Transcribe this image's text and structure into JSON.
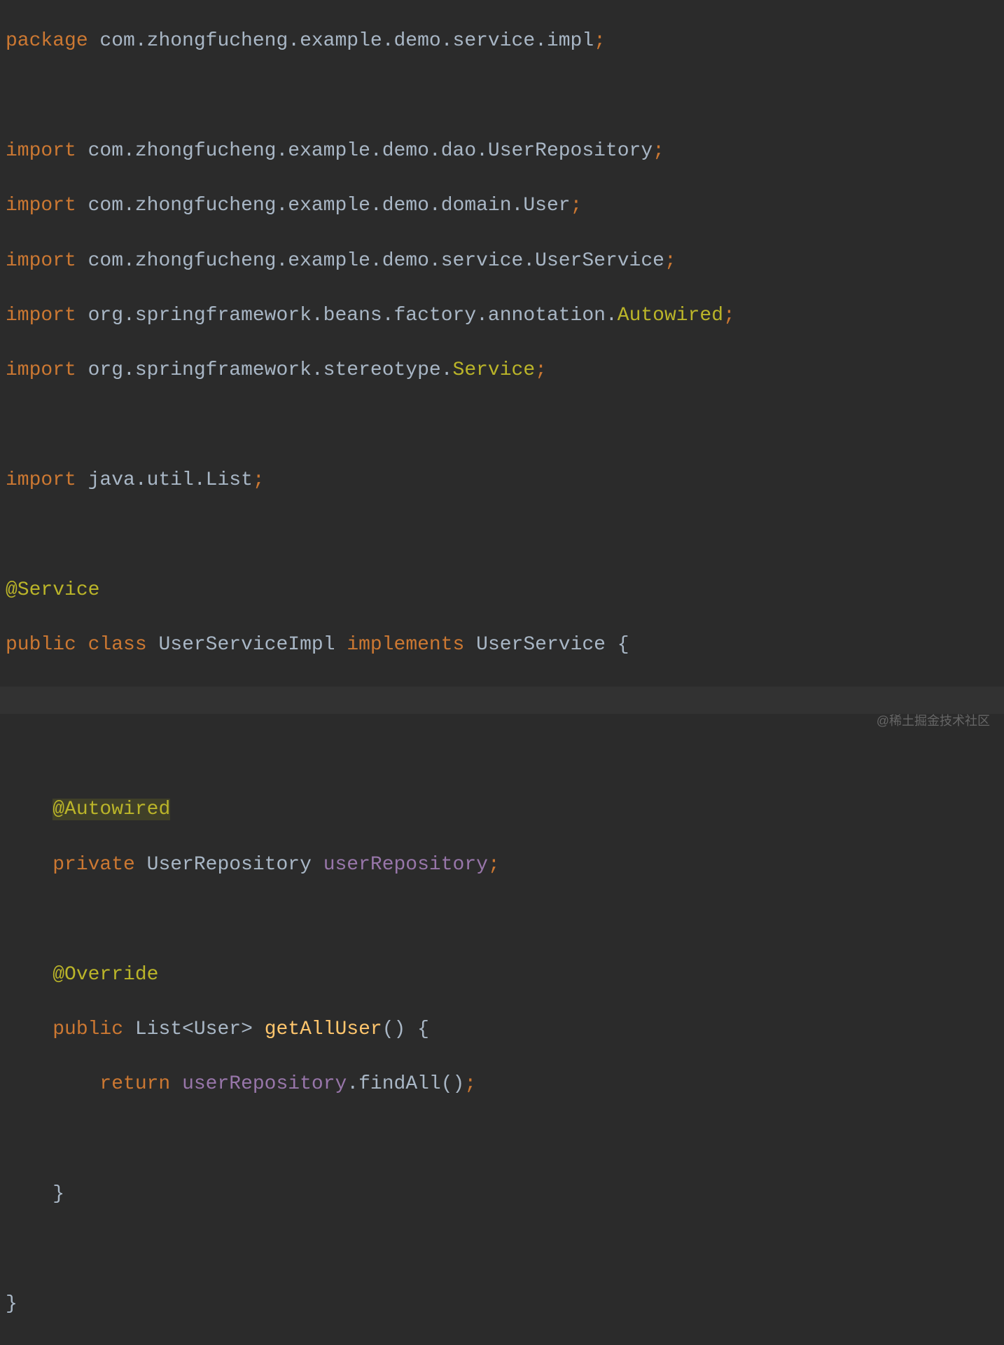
{
  "code": {
    "package_kw": "package",
    "package_name": " com.zhongfucheng.example.demo.service.impl",
    "import_kw": "import",
    "import1": " com.zhongfucheng.example.demo.dao.UserRepository",
    "import2": " com.zhongfucheng.example.demo.domain.User",
    "import3": " com.zhongfucheng.example.demo.service.UserService",
    "import4_pkg": " org.springframework.beans.factory.annotation.",
    "import4_cls": "Autowired",
    "import5_pkg": " org.springframework.stereotype.",
    "import5_cls": "Service",
    "import6": " java.util.List",
    "service_anno": "@Service",
    "public_kw": "public",
    "class_kw": "class",
    "class_name": " UserServiceImpl ",
    "implements_kw": "implements",
    "interface_name": " UserService ",
    "open_brace": "{",
    "autowired_anno": "@Autowired",
    "private_kw": "private",
    "repo_type": " UserRepository ",
    "repo_field": "userRepository",
    "override_anno": "@Override",
    "return_type": " List<User> ",
    "method_name": "getAllUser",
    "method_parens": "() ",
    "return_kw": "return",
    "return_field": "userRepository",
    "find_method": ".findAll()",
    "close_brace": "}",
    "semicolon": ";",
    "indent1": "    ",
    "indent2": "        "
  },
  "watermark": "@稀土掘金技术社区"
}
